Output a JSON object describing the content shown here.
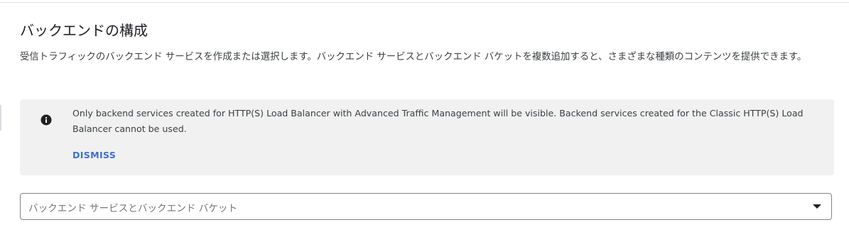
{
  "section": {
    "title": "バックエンドの構成",
    "description": "受信トラフィックのバックエンド サービスを作成または選択します。バックエンド サービスとバックエンド バケットを複数追加すると、さまざまな種類のコンテンツを提供できます。"
  },
  "notice": {
    "icon": "info-icon",
    "message": "Only backend services created for HTTP(S) Load Balancer with Advanced Traffic Management will be visible. Backend services created for the Classic HTTP(S) Load Balancer cannot be used.",
    "dismiss_label": "DISMISS"
  },
  "backend_select": {
    "placeholder": "バックエンド サービスとバックエンド バケット",
    "dropdown_icon": "arrow-drop-down-icon"
  }
}
